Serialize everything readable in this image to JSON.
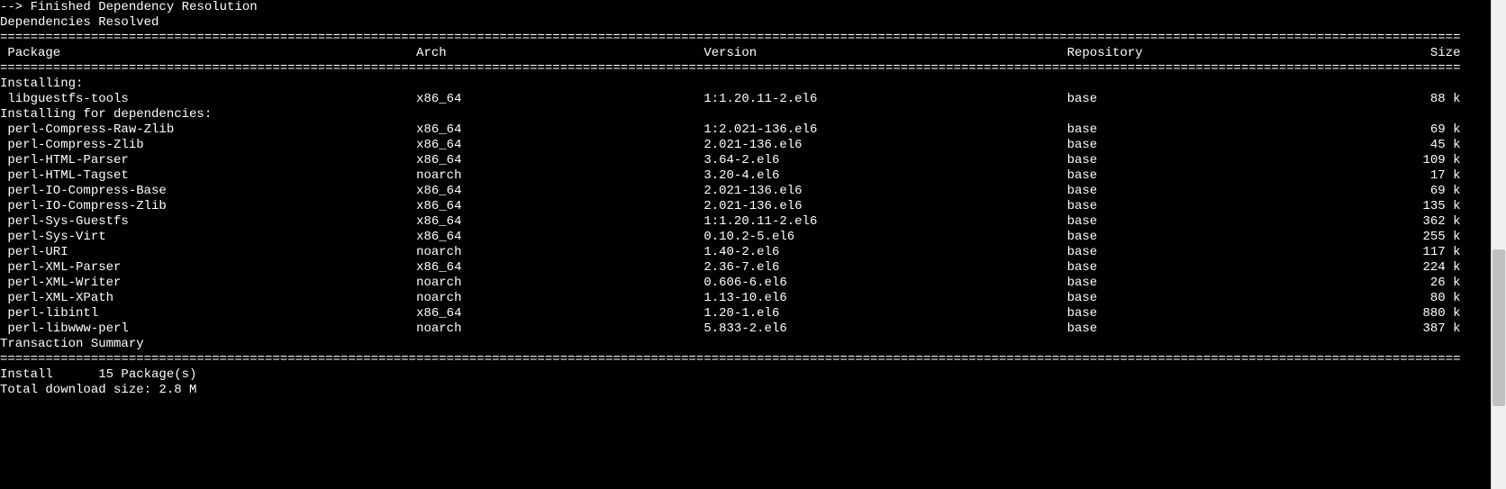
{
  "lines": {
    "finished": "--> Finished Dependency Resolution",
    "resolved": "Dependencies Resolved",
    "installing_hdr": "Installing:",
    "installing_deps_hdr": "Installing for dependencies:",
    "txn_summary": "Transaction Summary",
    "install_count": "Install      15 Package(s)",
    "total_size": "Total download size: 2.8 M"
  },
  "columns": {
    "package": "Package",
    "arch": "Arch",
    "version": "Version",
    "repository": "Repository",
    "size": "Size"
  },
  "separator_char": "=",
  "installing": [
    {
      "name": "libguestfs-tools",
      "arch": "x86_64",
      "version": "1:1.20.11-2.el6",
      "repo": "base",
      "size": "88 k"
    }
  ],
  "dependencies": [
    {
      "name": "perl-Compress-Raw-Zlib",
      "arch": "x86_64",
      "version": "1:2.021-136.el6",
      "repo": "base",
      "size": "69 k"
    },
    {
      "name": "perl-Compress-Zlib",
      "arch": "x86_64",
      "version": "2.021-136.el6",
      "repo": "base",
      "size": "45 k"
    },
    {
      "name": "perl-HTML-Parser",
      "arch": "x86_64",
      "version": "3.64-2.el6",
      "repo": "base",
      "size": "109 k"
    },
    {
      "name": "perl-HTML-Tagset",
      "arch": "noarch",
      "version": "3.20-4.el6",
      "repo": "base",
      "size": "17 k"
    },
    {
      "name": "perl-IO-Compress-Base",
      "arch": "x86_64",
      "version": "2.021-136.el6",
      "repo": "base",
      "size": "69 k"
    },
    {
      "name": "perl-IO-Compress-Zlib",
      "arch": "x86_64",
      "version": "2.021-136.el6",
      "repo": "base",
      "size": "135 k"
    },
    {
      "name": "perl-Sys-Guestfs",
      "arch": "x86_64",
      "version": "1:1.20.11-2.el6",
      "repo": "base",
      "size": "362 k"
    },
    {
      "name": "perl-Sys-Virt",
      "arch": "x86_64",
      "version": "0.10.2-5.el6",
      "repo": "base",
      "size": "255 k"
    },
    {
      "name": "perl-URI",
      "arch": "noarch",
      "version": "1.40-2.el6",
      "repo": "base",
      "size": "117 k"
    },
    {
      "name": "perl-XML-Parser",
      "arch": "x86_64",
      "version": "2.36-7.el6",
      "repo": "base",
      "size": "224 k"
    },
    {
      "name": "perl-XML-Writer",
      "arch": "noarch",
      "version": "0.606-6.el6",
      "repo": "base",
      "size": "26 k"
    },
    {
      "name": "perl-XML-XPath",
      "arch": "noarch",
      "version": "1.13-10.el6",
      "repo": "base",
      "size": "80 k"
    },
    {
      "name": "perl-libintl",
      "arch": "x86_64",
      "version": "1.20-1.el6",
      "repo": "base",
      "size": "880 k"
    },
    {
      "name": "perl-libwww-perl",
      "arch": "noarch",
      "version": "5.833-2.el6",
      "repo": "base",
      "size": "387 k"
    }
  ],
  "layout": {
    "total_width": 193,
    "col_package": 1,
    "col_arch": 55,
    "col_version": 93,
    "col_repo": 141,
    "col_size_right": 193,
    "indent_pkg": " "
  }
}
